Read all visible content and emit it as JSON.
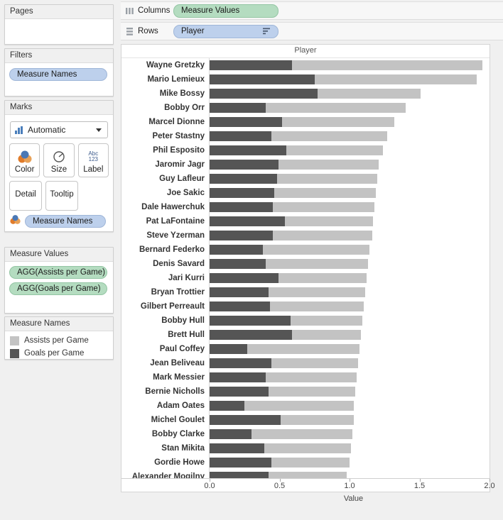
{
  "sidebar": {
    "pages": {
      "title": "Pages"
    },
    "filters": {
      "title": "Filters",
      "items": [
        {
          "label": "Measure Names"
        }
      ]
    },
    "marks": {
      "title": "Marks",
      "mark_type": "Automatic",
      "buttons": [
        {
          "label": "Color",
          "icon": "color-icon"
        },
        {
          "label": "Size",
          "icon": "size-icon"
        },
        {
          "label": "Label",
          "icon": "abc123-icon",
          "icon_top": "Abc",
          "icon_bottom": "123"
        },
        {
          "label": "Detail",
          "icon": "detail-icon"
        },
        {
          "label": "Tooltip",
          "icon": "tooltip-icon"
        }
      ],
      "encoding_pills": [
        {
          "label": "Measure Names",
          "icon": "color-icon"
        }
      ]
    },
    "measure_values": {
      "title": "Measure Values",
      "items": [
        {
          "label": "AGG(Assists per Game)"
        },
        {
          "label": "AGG(Goals per Game)"
        }
      ]
    },
    "measure_names_legend": {
      "title": "Measure Names",
      "items": [
        {
          "label": "Assists per Game",
          "color": "#c3c3c3"
        },
        {
          "label": "Goals per Game",
          "color": "#555555"
        }
      ]
    }
  },
  "shelves": {
    "columns": {
      "label": "Columns",
      "pills": [
        {
          "label": "Measure Values",
          "type": "green"
        }
      ]
    },
    "rows": {
      "label": "Rows",
      "pills": [
        {
          "label": "Player",
          "type": "blue",
          "sorted": true
        }
      ]
    }
  },
  "chart_data": {
    "type": "bar",
    "title": "",
    "subtitle": "",
    "orientation": "horizontal",
    "stacked": true,
    "field_header": "Player",
    "xlabel": "Value",
    "ylabel": "",
    "xlim": [
      0,
      2.0
    ],
    "xticks": [
      0.0,
      0.5,
      1.0,
      1.5,
      2.0
    ],
    "xtick_labels": [
      "0.0",
      "0.5",
      "1.0",
      "1.5",
      "2.0"
    ],
    "grid": false,
    "legend_position": "left-panel",
    "series": [
      {
        "name": "Goals per Game",
        "color": "#555555",
        "values": [
          0.59,
          0.75,
          0.77,
          0.4,
          0.52,
          0.44,
          0.55,
          0.49,
          0.48,
          0.46,
          0.45,
          0.54,
          0.45,
          0.38,
          0.4,
          0.49,
          0.42,
          0.43,
          0.58,
          0.59,
          0.27,
          0.44,
          0.4,
          0.42,
          0.25,
          0.51,
          0.3,
          0.39,
          0.44,
          0.42
        ]
      },
      {
        "name": "Assists per Game",
        "color": "#c3c3c3",
        "values": [
          1.36,
          1.16,
          0.74,
          1.0,
          0.8,
          0.83,
          0.69,
          0.72,
          0.72,
          0.73,
          0.73,
          0.63,
          0.71,
          0.76,
          0.73,
          0.63,
          0.69,
          0.67,
          0.51,
          0.49,
          0.8,
          0.62,
          0.65,
          0.62,
          0.78,
          0.52,
          0.72,
          0.62,
          0.56,
          0.56
        ]
      }
    ],
    "categories": [
      "Wayne Gretzky",
      "Mario Lemieux",
      "Mike Bossy",
      "Bobby Orr",
      "Marcel Dionne",
      "Peter Stastny",
      "Phil Esposito",
      "Jaromir Jagr",
      "Guy Lafleur",
      "Joe Sakic",
      "Dale Hawerchuk",
      "Pat LaFontaine",
      "Steve Yzerman",
      "Bernard Federko",
      "Denis Savard",
      "Jari Kurri",
      "Bryan Trottier",
      "Gilbert Perreault",
      "Bobby Hull",
      "Brett Hull",
      "Paul Coffey",
      "Jean Beliveau",
      "Mark Messier",
      "Bernie Nicholls",
      "Adam Oates",
      "Michel Goulet",
      "Bobby Clarke",
      "Stan Mikita",
      "Gordie Howe",
      "Alexander Mogilny"
    ]
  },
  "scrollbar": {
    "up_icon": "triangle-up-icon",
    "down_icon": "triangle-down-icon"
  },
  "colors": {
    "pill_green": "#b4dcc0",
    "pill_blue": "#bdd0ec",
    "bar_dark": "#555555",
    "bar_light": "#c3c3c3"
  }
}
